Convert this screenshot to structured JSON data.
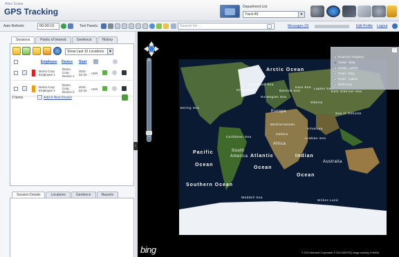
{
  "header": {
    "brand_small": "Altec Scalar",
    "app_title": "GPS Tracking",
    "department_label": "Department List",
    "department_value": "Track All",
    "icons": [
      "binoculars-icon",
      "globe-icon",
      "tools-icon",
      "chart-icon",
      "settings-icon",
      "lock-icon"
    ]
  },
  "toolbar": {
    "auto_refresh_label": "Auto Refresh:",
    "auto_refresh_value": "00:00:15",
    "tool_panels_label": "Tool Panels:",
    "search_placeholder": "Search for ...",
    "messages_link": "Messages (0)",
    "edit_profile_link": "Edit Profile",
    "logout_link": "Logout"
  },
  "left_panel": {
    "top_tabs": [
      "Sessions",
      "Points of Interest",
      "Geofence",
      "History"
    ],
    "show_last_value": "Show Last 10 Locations",
    "columns": [
      "Employee",
      "Device",
      "Start"
    ],
    "rows": [
      {
        "employee": [
          "Demo Corp",
          "Employee 1"
        ],
        "device": [
          "Demo",
          "Corp",
          "Device 1"
        ],
        "start": [
          "2011-",
          "02-22"
        ],
        "age": "+24h",
        "color": "#e02020"
      },
      {
        "employee": [
          "Demo Corp",
          "Employee 2"
        ],
        "device": [
          "Demo",
          "Corp",
          "Device 2"
        ],
        "start": [
          "2011-",
          "02-22"
        ],
        "age": "+24h",
        "color": "#f09a10"
      }
    ],
    "items_count": "2 Items",
    "add_device_link": "Add A New Device",
    "bottom_tabs": [
      "Session Details",
      "Locations",
      "Geofence",
      "Reports"
    ]
  },
  "map": {
    "labels": {
      "arctic_ocean": "Arctic Ocean",
      "pacific": "Pacific",
      "ocean_left": "Ocean",
      "atlantic": "Atlantic",
      "ocean_mid": "Ocean",
      "indian": "Indian",
      "ocean_right": "Ocean",
      "southern_ocean": "Southern Ocean",
      "europe": "Europe",
      "africa": "Africa",
      "south_america": "South",
      "south_america2": "America",
      "australia": "Australia",
      "antarctica": "Antarctica",
      "greenland": "Greenland",
      "greenland_sea": "Greenland Sea",
      "norwegian_sea": "Norwegian Sea",
      "barents_sea": "Barents Sea",
      "kara_sea": "Kara Sea",
      "laptev_sea": "Laptev Sea",
      "east_siberian_sea": "East Siberian Sea",
      "bering_sea": "Bering Sea",
      "sea_of_okhotsk": "Sea of Okhotsk",
      "caribbean_sea": "Caribbean Sea",
      "mediterranean": "Mediterranean",
      "arabian_sea": "Arabian Sea",
      "weddell_sea": "Weddell Sea",
      "ross_sea": "Ross Sea",
      "wilkes_land": "Wilkes Land",
      "queen_maud_land": "Queen Maud Land",
      "siberia": "Siberia",
      "himalaya": "Himalaya",
      "sahara": "Sahara"
    },
    "legend_items": [
      "Road (no imagery)",
      "Aerial - Bing",
      "Aerial - Labels",
      "Road - Bing",
      "Road - Labels",
      "Bird's Eye"
    ],
    "bing_logo": "bing",
    "copyright": "© 2011 Microsoft Corporation   © 2010 NAVTEQ   Image courtesy of NASA"
  }
}
